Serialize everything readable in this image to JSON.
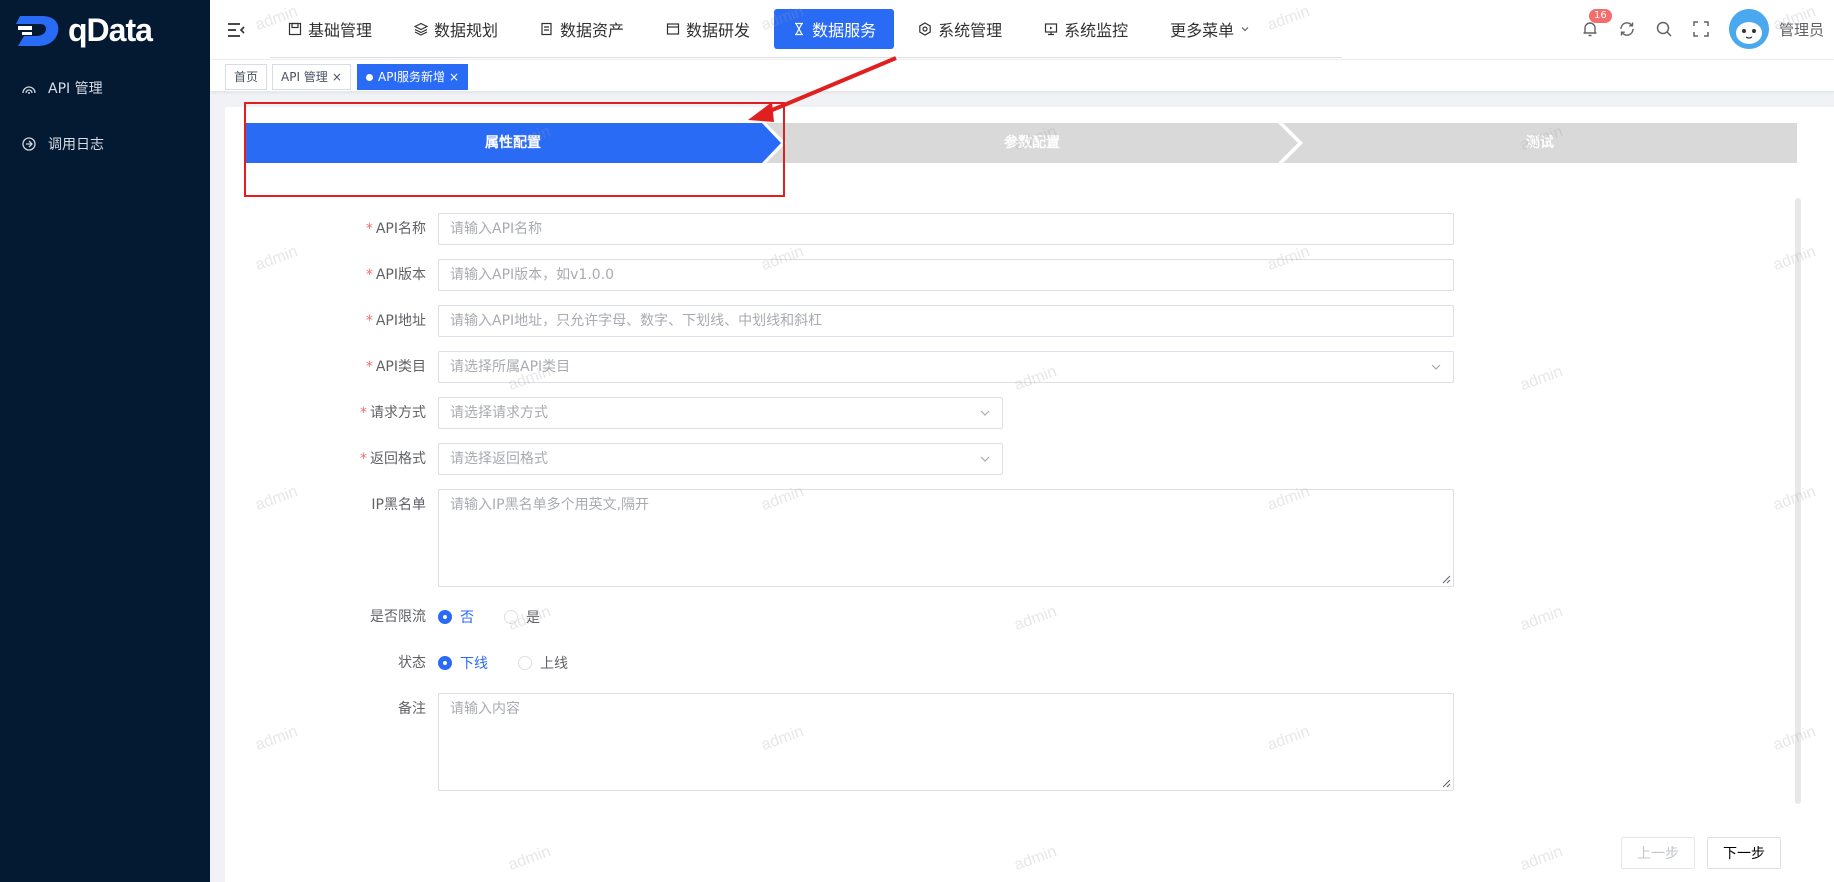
{
  "sidebar": {
    "logo_text": "qData",
    "items": [
      {
        "label": "API 管理",
        "icon": "api-icon"
      },
      {
        "label": "调用日志",
        "icon": "log-icon"
      }
    ]
  },
  "topnav": {
    "items": [
      {
        "label": "基础管理",
        "icon": "save-icon"
      },
      {
        "label": "数据规划",
        "icon": "layers-icon"
      },
      {
        "label": "数据资产",
        "icon": "doc-icon"
      },
      {
        "label": "数据研发",
        "icon": "window-icon"
      },
      {
        "label": "数据服务",
        "icon": "hourglass-icon",
        "active": true
      },
      {
        "label": "系统管理",
        "icon": "settings-icon"
      },
      {
        "label": "系统监控",
        "icon": "monitor-icon"
      },
      {
        "label": "更多菜单",
        "icon": "chevron-down-icon"
      }
    ],
    "notification_count": "16",
    "user_name": "管理员"
  },
  "tags": [
    {
      "label": "首页"
    },
    {
      "label": "API 管理"
    },
    {
      "label": "API服务新增",
      "active": true
    }
  ],
  "steps": [
    {
      "label": "属性配置",
      "active": true
    },
    {
      "label": "参数配置"
    },
    {
      "label": "测试"
    }
  ],
  "form": {
    "api_name": {
      "label": "API名称",
      "placeholder": "请输入API名称"
    },
    "api_version": {
      "label": "API版本",
      "placeholder": "请输入API版本，如v1.0.0"
    },
    "api_path": {
      "label": "API地址",
      "placeholder": "请输入API地址，只允许字母、数字、下划线、中划线和斜杠"
    },
    "api_category": {
      "label": "API类目",
      "placeholder": "请选择所属API类目"
    },
    "request_method": {
      "label": "请求方式",
      "placeholder": "请选择请求方式"
    },
    "return_format": {
      "label": "返回格式",
      "placeholder": "请选择返回格式"
    },
    "ip_blacklist": {
      "label": "IP黑名单",
      "placeholder": "请输入IP黑名单多个用英文,隔开"
    },
    "rate_limit": {
      "label": "是否限流",
      "options": [
        "否",
        "是"
      ],
      "selected": "否"
    },
    "status": {
      "label": "状态",
      "options": [
        "下线",
        "上线"
      ],
      "selected": "下线"
    },
    "remark": {
      "label": "备注",
      "placeholder": "请输入内容"
    }
  },
  "buttons": {
    "prev": "上一步",
    "next": "下一步"
  },
  "watermark_text": "admin",
  "colors": {
    "primary": "#2a6bf6",
    "sidebar_bg": "#041a33",
    "annotation": "#e02020"
  }
}
